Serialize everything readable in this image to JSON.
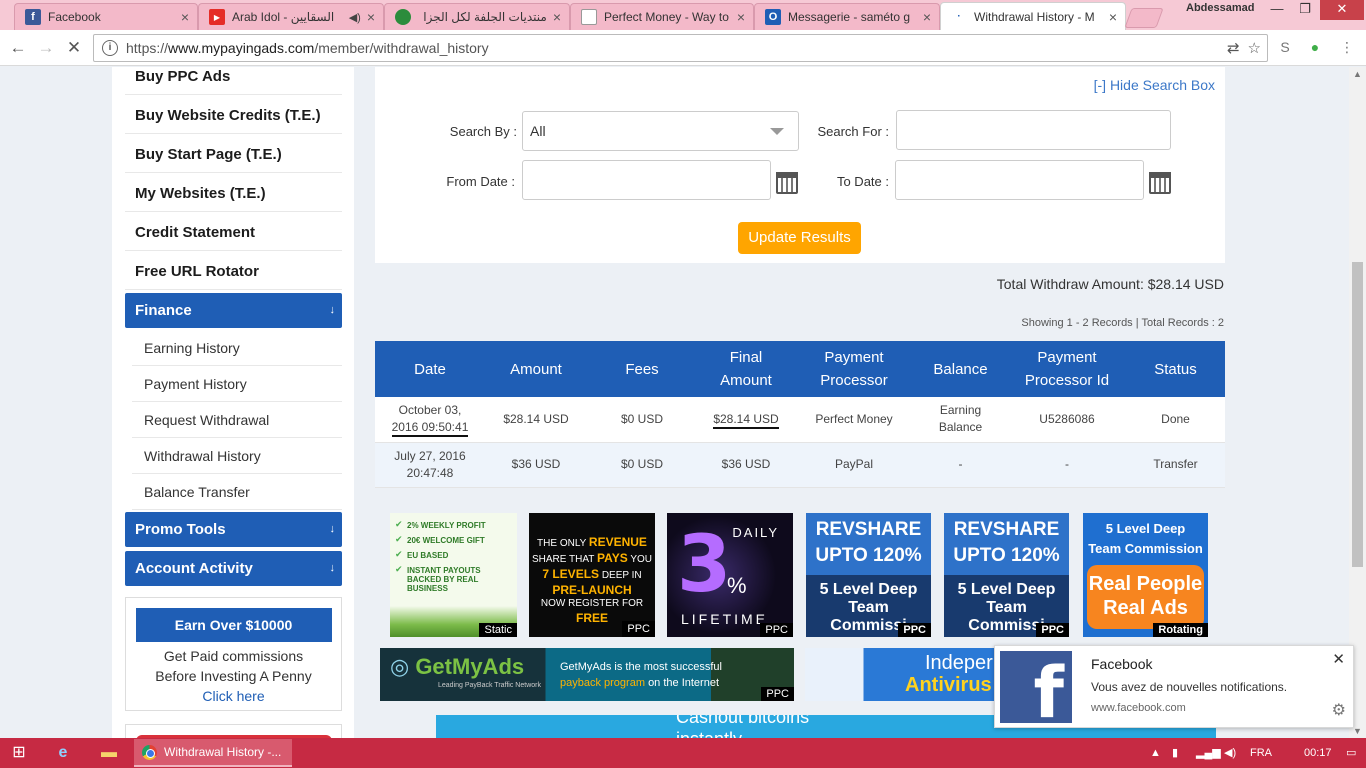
{
  "browser": {
    "tabs": [
      {
        "label": "Facebook",
        "icon": "facebook-icon",
        "color": "#3b5998"
      },
      {
        "label": "Arab Idol - السقايين",
        "icon": "youtube-icon",
        "color": "#e52d27"
      },
      {
        "label": "منتديات الجلفة لكل الجزا",
        "icon": "forum-icon",
        "color": "#2c8c3c"
      },
      {
        "label": "Perfect Money - Way to",
        "icon": "page-icon",
        "color": "#888888"
      },
      {
        "label": "Messagerie - saméto g",
        "icon": "outlook-icon",
        "color": "#1f5eb5"
      },
      {
        "label": "Withdrawal History - M",
        "icon": "loading-icon",
        "color": "#1f5eb5"
      }
    ],
    "user": "Abdessamad",
    "url_prefix": "https://",
    "url_host": "www.mypayingads.com",
    "url_path": "/member/withdrawal_history"
  },
  "sidebar": {
    "items": [
      "Buy PPC Ads",
      "Buy Website Credits (T.E.)",
      "Buy Start Page (T.E.)",
      "My Websites (T.E.)",
      "Credit Statement",
      "Free URL Rotator"
    ],
    "finance": {
      "label": "Finance",
      "arrow": "↓"
    },
    "finance_items": [
      "Earning History",
      "Payment History",
      "Request Withdrawal",
      "Withdrawal History",
      "Balance Transfer"
    ],
    "promo_tools": {
      "label": "Promo Tools",
      "arrow": "↓"
    },
    "account_activity": {
      "label": "Account Activity",
      "arrow": "↓"
    },
    "promo": {
      "button": "Earn Over $10000",
      "line1": "Get Paid commissions",
      "line2": "Before Investing A Penny",
      "link": "Click here"
    }
  },
  "search": {
    "hide_link": "[-] Hide Search Box",
    "search_by_label": "Search By :",
    "search_by_value": "All",
    "search_for_label": "Search For :",
    "search_for_value": "",
    "from_date_label": "From Date :",
    "from_date_value": "",
    "to_date_label": "To Date :",
    "to_date_value": "",
    "update_button": "Update Results"
  },
  "summary": {
    "total": "Total Withdraw Amount: $28.14 USD",
    "showing": "Showing 1 - 2 Records | Total Records : 2"
  },
  "table": {
    "headers": [
      "Date",
      "Amount",
      "Fees",
      "Final Amount",
      "Payment Processor",
      "Balance",
      "Payment Processor Id",
      "Status"
    ],
    "rows": [
      {
        "date_a": "October 03,",
        "date_b": "2016 09:50:41",
        "amount": "$28.14 USD",
        "fees": "$0 USD",
        "final": "$28.14 USD",
        "processor": "Perfect Money",
        "balance_a": "Earning",
        "balance_b": "Balance",
        "processor_id": "U5286086",
        "status": "Done"
      },
      {
        "date_a": "July 27, 2016",
        "date_b": "20:47:48",
        "amount": "$36 USD",
        "fees": "$0 USD",
        "final": "$36 USD",
        "processor": "PayPal",
        "balance_a": "-",
        "balance_b": "",
        "processor_id": "-",
        "status": "Transfer"
      }
    ]
  },
  "ads": {
    "ad1": {
      "lines": [
        "2% WEEKLY PROFIT",
        "20€ WELCOME GIFT",
        "EU BASED",
        "INSTANT PAYOUTS",
        "BACKED BY REAL BUSINESS"
      ],
      "tag": "Static"
    },
    "ad2": {
      "l1": "THE ONLY",
      "l1b": "REVENUE",
      "l2": "SHARE THAT",
      "l2b": "PAYS",
      "l2c": "YOU",
      "l3": "7 LEVELS",
      "l3b": "DEEP IN",
      "l4": "PRE-LAUNCH",
      "l5": "NOW REGISTER FOR",
      "l6": "FREE",
      "tag": "PPC"
    },
    "ad3": {
      "big": "3",
      "pct": "%",
      "daily": "DAILY",
      "lifetime": "LIFETIME",
      "tag": "PPC"
    },
    "ad4": {
      "t1": "REVSHARE",
      "t2": "UPTO 120%",
      "t3": "5 Level Deep",
      "t4": "Team",
      "t5": "Commissi",
      "tag": "PPC"
    },
    "ad5": {
      "t1": "REVSHARE",
      "t2": "UPTO 120%",
      "t3": "5 Level Deep",
      "t4": "Team",
      "t5": "Commissi",
      "tag": "PPC"
    },
    "ad6": {
      "t1": "5 Level Deep",
      "t2": "Team Commission",
      "t3": "Real People",
      "t4": "Real Ads",
      "tag": "Rotating"
    },
    "ad7": {
      "logo_a": "Get",
      "logo_b": "MyAds",
      "sub": "Leading PayBack Traffic Network",
      "m1": "GetMyAds is the most successful",
      "m2": "payback program",
      "m3": "on the Internet",
      "tag": "PPC"
    },
    "ad8": {
      "a": "Indeper",
      "b": "Antivirus"
    },
    "ad9": {
      "a": "Cashout bitcoins",
      "b": "instantly"
    }
  },
  "notification": {
    "title": "Facebook",
    "body": "Vous avez de nouvelles notifications.",
    "source": "www.facebook.com"
  },
  "taskbar": {
    "task_label": "Withdrawal History -...",
    "lang": "FRA",
    "time": "00:17"
  }
}
